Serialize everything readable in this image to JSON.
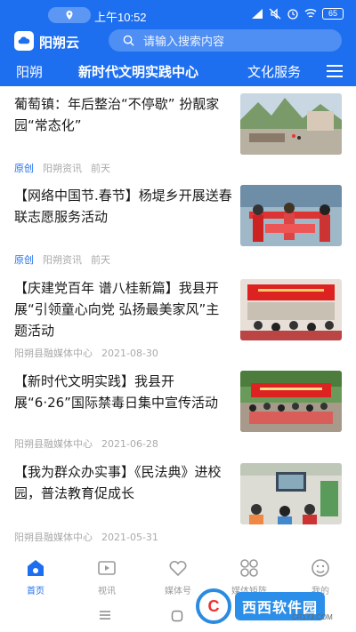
{
  "status_bar": {
    "time": "上午10:52",
    "battery": "65"
  },
  "header": {
    "app_name": "阳朔云",
    "search_placeholder": "请输入搜索内容",
    "brand_color": "#1e6ff0"
  },
  "tabs": [
    {
      "label": "阳朔",
      "active": false
    },
    {
      "label": "新时代文明实践中心",
      "active": true
    },
    {
      "label": "文化服务",
      "active": false
    }
  ],
  "articles": [
    {
      "title": "葡萄镇：年后整治“不停歇” 扮靓家园“常态化”",
      "tag": "原创",
      "source": "阳朔资讯",
      "time": "前天",
      "thumb_icon": "village-photo"
    },
    {
      "title": "【网络中国节.春节】杨堤乡开展送春联志愿服务活动",
      "tag": "原创",
      "source": "阳朔资讯",
      "time": "前天",
      "thumb_icon": "volunteers-photo"
    },
    {
      "title": "【庆建党百年 谱八桂新篇】我县开展“引领童心向党 弘扬最美家风”主题活动",
      "tag": "",
      "source": "阳朔县融媒体中心",
      "time": "2021-08-30",
      "thumb_icon": "stage-event-photo"
    },
    {
      "title": "【新时代文明实践】我县开展“6·26”国际禁毒日集中宣传活动",
      "tag": "",
      "source": "阳朔县融媒体中心",
      "time": "2021-06-28",
      "thumb_icon": "banner-crowd-photo"
    },
    {
      "title": "【我为群众办实事】《民法典》进校园，普法教育促成长",
      "tag": "",
      "source": "阳朔县融媒体中心",
      "time": "2021-05-31",
      "thumb_icon": "classroom-photo"
    }
  ],
  "bottom_nav": [
    {
      "label": "首页",
      "icon": "home-icon",
      "active": true
    },
    {
      "label": "视讯",
      "icon": "video-icon",
      "active": false
    },
    {
      "label": "媒体号",
      "icon": "heart-hand-icon",
      "active": false
    },
    {
      "label": "媒体矩阵",
      "icon": "grid-icon",
      "active": false
    },
    {
      "label": "我的",
      "icon": "smile-icon",
      "active": false
    }
  ],
  "watermark": {
    "logo_letter": "C",
    "text": "西西软件园",
    "sub": "CR173.COM"
  }
}
